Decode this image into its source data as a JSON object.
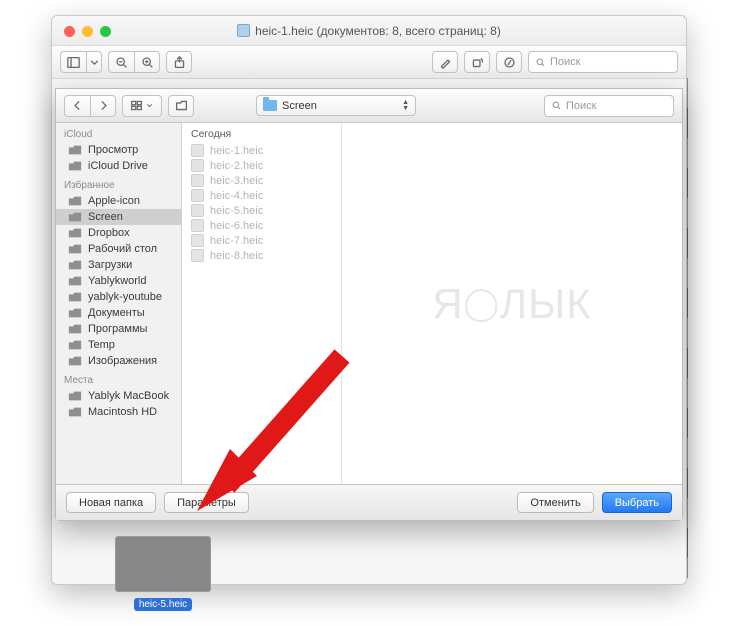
{
  "window": {
    "title": "heic-1.heic (документов: 8, всего страниц: 8)",
    "search_placeholder": "Поиск"
  },
  "dialog": {
    "path_button": "Screen",
    "search_placeholder": "Поиск",
    "list_header": "Сегодня",
    "files": [
      "heic-1.heic",
      "heic-2.heic",
      "heic-3.heic",
      "heic-4.heic",
      "heic-5.heic",
      "heic-6.heic",
      "heic-7.heic",
      "heic-8.heic"
    ],
    "footer": {
      "new_folder": "Новая папка",
      "options": "Параметры",
      "cancel": "Отменить",
      "choose": "Выбрать"
    }
  },
  "sidebar": {
    "groups": [
      {
        "title": "iCloud",
        "items": [
          "Просмотр",
          "iCloud Drive"
        ]
      },
      {
        "title": "Избранное",
        "items": [
          "Apple-icon",
          "Screen",
          "Dropbox",
          "Рабочий стол",
          "Загрузки",
          "Yablykworld",
          "yablyk-youtube",
          "Документы",
          "Программы",
          "Temp",
          "Изображения"
        ]
      },
      {
        "title": "Места",
        "items": [
          "Yablyk MacBook",
          "Macintosh HD"
        ]
      }
    ],
    "selected": "Screen"
  },
  "background_thumb_label": "heic-5.heic",
  "watermark_text": "ЯБЛЫК"
}
